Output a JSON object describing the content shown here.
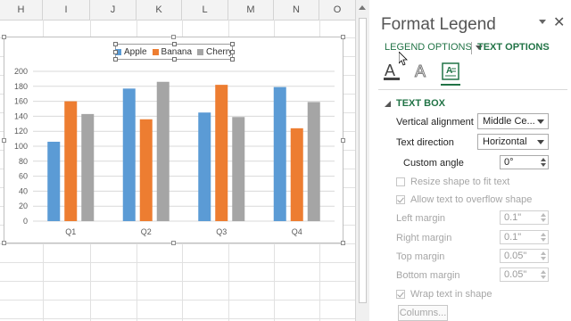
{
  "sheet": {
    "columns": [
      "H",
      "I",
      "J",
      "K",
      "L",
      "M",
      "N",
      "O"
    ]
  },
  "chart_data": {
    "type": "bar",
    "categories": [
      "Q1",
      "Q2",
      "Q3",
      "Q4"
    ],
    "series": [
      {
        "name": "Apple",
        "color": "#5b9bd5",
        "values": [
          106,
          177,
          145,
          179
        ]
      },
      {
        "name": "Banana",
        "color": "#ed7d31",
        "values": [
          160,
          136,
          182,
          124
        ]
      },
      {
        "name": "Cherry",
        "color": "#a5a5a5",
        "values": [
          143,
          186,
          139,
          159
        ]
      }
    ],
    "ylim": [
      0,
      200
    ],
    "yticks": [
      "0",
      "20",
      "40",
      "60",
      "80",
      "100",
      "120",
      "140",
      "160",
      "180",
      "200"
    ],
    "grid": true,
    "legend": "top"
  },
  "pane": {
    "title": "Format Legend",
    "close_glyph": "✕",
    "tab_legend_options": "LEGEND OPTIONS",
    "tab_text_options": "TEXT OPTIONS",
    "icons": [
      "text-fill-outline-icon",
      "text-effects-icon",
      "textbox-icon"
    ],
    "section_title": "TEXT BOX",
    "vertical_alignment": {
      "label": "Vertical alignment",
      "value": "Middle Ce..."
    },
    "text_direction": {
      "label": "Text direction",
      "value": "Horizontal"
    },
    "custom_angle": {
      "label": "Custom angle",
      "value": "0°"
    },
    "resize_shape": "Resize shape to fit text",
    "allow_overflow": "Allow text to overflow shape",
    "left_margin": {
      "label": "Left margin",
      "value": "0.1\""
    },
    "right_margin": {
      "label": "Right margin",
      "value": "0.1\""
    },
    "top_margin": {
      "label": "Top margin",
      "value": "0.05\""
    },
    "bottom_margin": {
      "label": "Bottom margin",
      "value": "0.05\""
    },
    "wrap_text": "Wrap text in shape",
    "columns_button": "Columns..."
  }
}
